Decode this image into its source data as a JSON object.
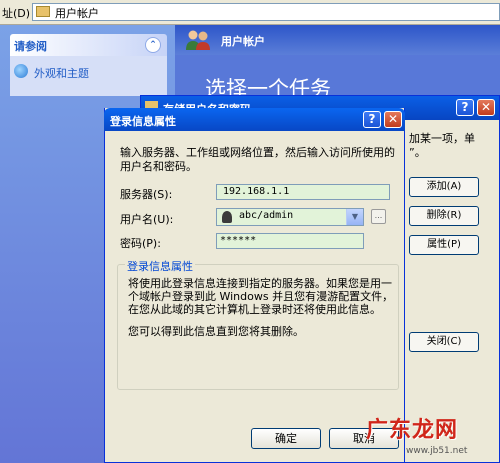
{
  "address_bar": {
    "label": "址(D)",
    "value": "用户帐户"
  },
  "left_pane": {
    "see_also_title": "请参阅",
    "collapse_symbol": "⌃",
    "links": [
      {
        "label": "外观和主题",
        "icon": "appearance-icon"
      }
    ]
  },
  "main_panel": {
    "title": "用户帐户",
    "task_heading": "选择一个任务"
  },
  "background_dialog": {
    "title": "存储用户名和密码",
    "help_symbol": "?",
    "close_symbol": "✕",
    "description_line1": "加某一项，单",
    "description_line2": "”。",
    "buttons": {
      "add": "添加(A)",
      "remove": "删除(R)",
      "properties": "属性(P)",
      "close": "关闭(C)"
    }
  },
  "dialog": {
    "title": "登录信息属性",
    "help_symbol": "?",
    "close_symbol": "✕",
    "intro": "输入服务器、工作组或网络位置，然后输入访问所使用的用户名和密码。",
    "server_label": "服务器(S):",
    "server_value": "192.168.1.1",
    "username_label": "用户名(U):",
    "username_value": "abc/admin",
    "combo_arrow": "▼",
    "browse_label": "...",
    "password_label": "密码(P):",
    "password_value": "******",
    "group_title": "登录信息属性",
    "group_text_1": "将使用此登录信息连接到指定的服务器。如果您是用一个域帐户登录到此 Windows 并且您有漫游配置文件，在您从此域的其它计算机上登录时还将使用此信息。",
    "group_text_2": "您可以得到此信息直到您将其删除。",
    "ok_label": "确定",
    "cancel_label": "取消"
  },
  "watermark": {
    "logo": "广东龙网",
    "url": "www.jb51.net"
  },
  "colors": {
    "title_bar": "#0a5fe6",
    "task_pane": "#6375d6",
    "field_fill": "#e2f3d9",
    "link": "#215dc6"
  }
}
